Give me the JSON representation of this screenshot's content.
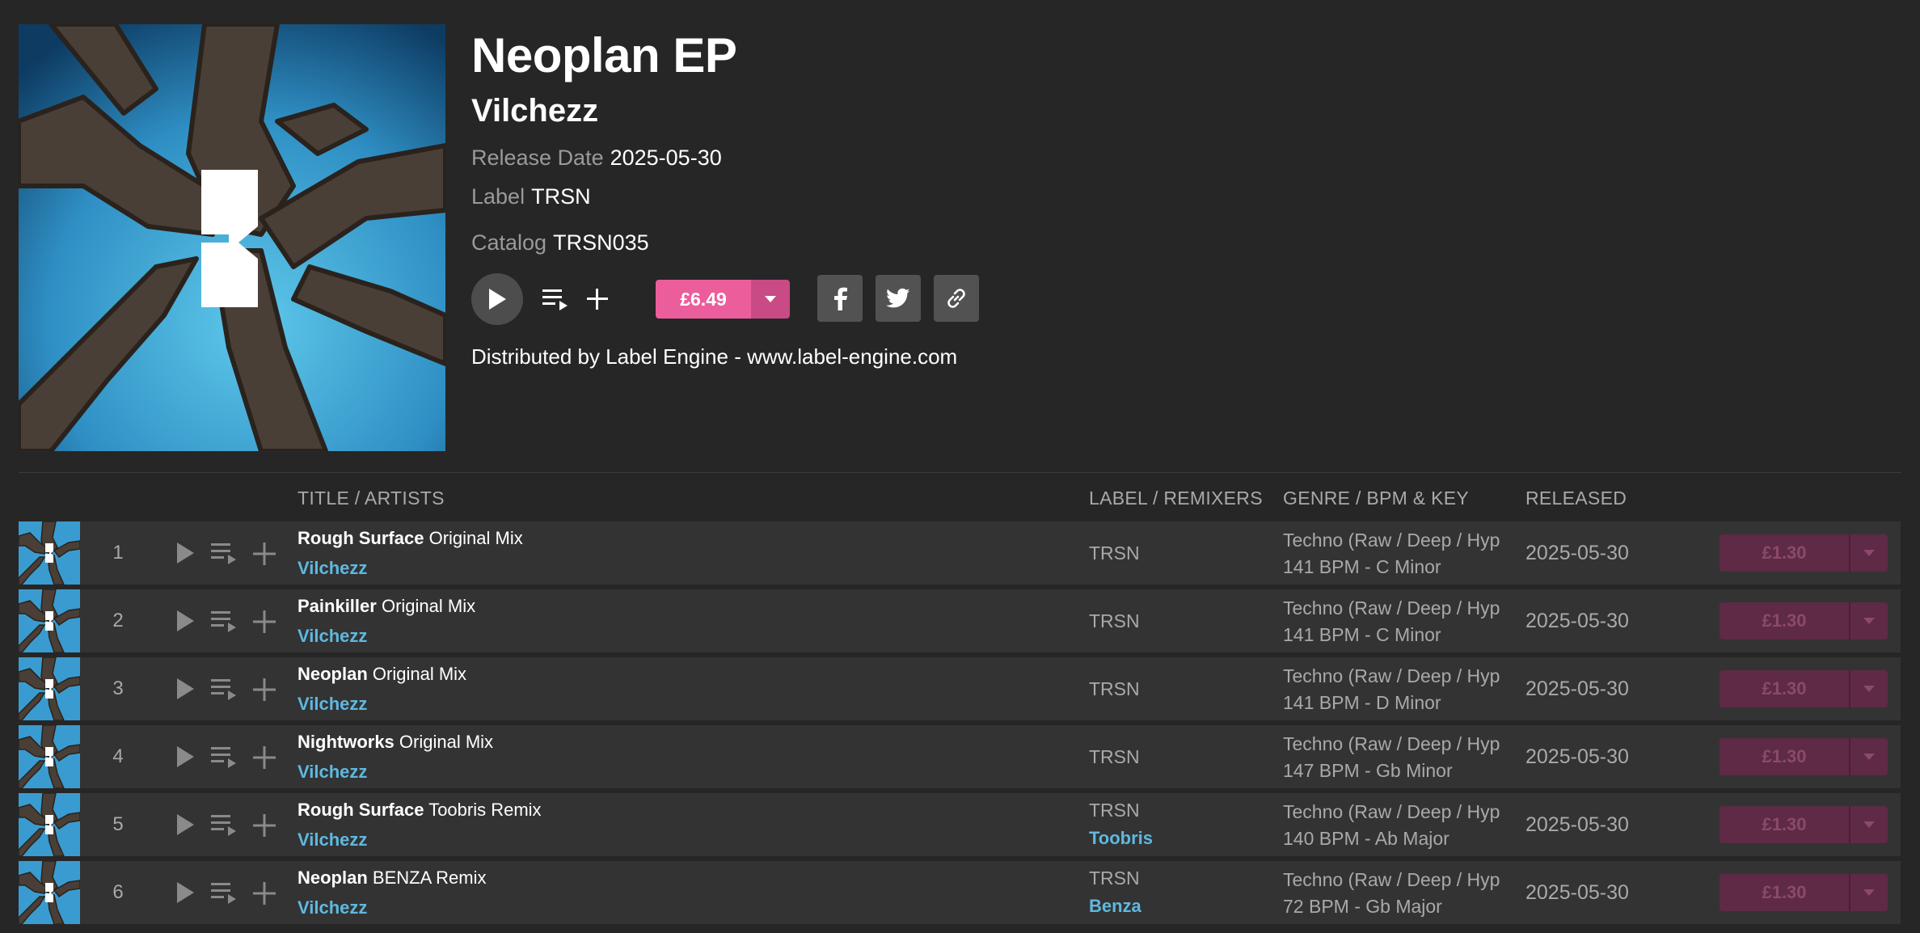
{
  "release": {
    "title": "Neoplan EP",
    "artist": "Vilchezz",
    "release_date_label": "Release Date",
    "release_date": "2025-05-30",
    "label_label": "Label",
    "label": "TRSN",
    "catalog_label": "Catalog",
    "catalog": "TRSN035",
    "price": "£6.49",
    "distributed_by": "Distributed by Label Engine - www.label-engine.com"
  },
  "colors": {
    "background": "#262626",
    "row_background": "#333333",
    "accent_pink": "#ec5d9c",
    "artist_blue": "#5fb8e0",
    "muted_text": "#a9a9a9"
  },
  "table": {
    "headers": {
      "title_artists": "TITLE / ARTISTS",
      "label_remixers": "LABEL / REMIXERS",
      "genre_bpm_key": "GENRE / BPM & KEY",
      "released": "RELEASED"
    },
    "tracks": [
      {
        "num": "1",
        "title": "Rough Surface",
        "mix": "Original Mix",
        "artist": "Vilchezz",
        "label": "TRSN",
        "remixer": "",
        "genre": "Techno (Raw / Deep / Hypnotic)",
        "bpm_key": "141 BPM - C Minor",
        "released": "2025-05-30",
        "price": "£1.30"
      },
      {
        "num": "2",
        "title": "Painkiller",
        "mix": "Original Mix",
        "artist": "Vilchezz",
        "label": "TRSN",
        "remixer": "",
        "genre": "Techno (Raw / Deep / Hypnotic)",
        "bpm_key": "141 BPM - C Minor",
        "released": "2025-05-30",
        "price": "£1.30"
      },
      {
        "num": "3",
        "title": "Neoplan",
        "mix": "Original Mix",
        "artist": "Vilchezz",
        "label": "TRSN",
        "remixer": "",
        "genre": "Techno (Raw / Deep / Hypnotic)",
        "bpm_key": "141 BPM - D Minor",
        "released": "2025-05-30",
        "price": "£1.30"
      },
      {
        "num": "4",
        "title": "Nightworks",
        "mix": "Original Mix",
        "artist": "Vilchezz",
        "label": "TRSN",
        "remixer": "",
        "genre": "Techno (Raw / Deep / Hypnotic)",
        "bpm_key": "147 BPM - Gb Minor",
        "released": "2025-05-30",
        "price": "£1.30"
      },
      {
        "num": "5",
        "title": "Rough Surface",
        "mix": "Toobris Remix",
        "artist": "Vilchezz",
        "label": "TRSN",
        "remixer": "Toobris",
        "genre": "Techno (Raw / Deep / Hypnotic)",
        "bpm_key": "140 BPM - Ab Major",
        "released": "2025-05-30",
        "price": "£1.30"
      },
      {
        "num": "6",
        "title": "Neoplan",
        "mix": "BENZA Remix",
        "artist": "Vilchezz",
        "label": "TRSN",
        "remixer": "Benza",
        "genre": "Techno (Raw / Deep / Hypnotic)",
        "bpm_key": "72 BPM - Gb Major",
        "released": "2025-05-30",
        "price": "£1.30"
      }
    ]
  }
}
